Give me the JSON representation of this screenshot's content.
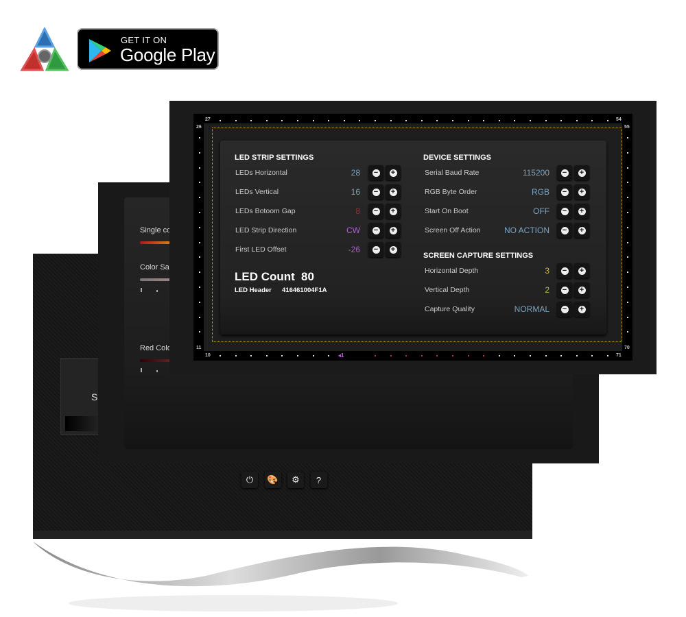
{
  "badge": {
    "line1": "GET IT ON",
    "line2": "Google Play"
  },
  "back_screen": {
    "card_label": "Sl"
  },
  "middle_screen": {
    "labels": [
      "Single co",
      "Color Sat",
      "Red Colo"
    ]
  },
  "led_frame": {
    "corner_labels": {
      "top_left_a": "27",
      "top_left_b": "26",
      "top_right_a": "54",
      "top_right_b": "55",
      "bottom_left_a": "11",
      "bottom_left_b": "10",
      "bottom_right_a": "70",
      "bottom_right_b": "71"
    },
    "start_marker": "◂1",
    "colors": {
      "start": "#c05de0",
      "active": "#c0392b",
      "idle": "#dddddd",
      "guide": "#b9a93a"
    }
  },
  "led_strip": {
    "title": "LED STRIP SETTINGS",
    "rows": [
      {
        "label": "LEDs Horizontal",
        "value": "28",
        "color": "#7aa3c4"
      },
      {
        "label": "LEDs Vertical",
        "value": "16",
        "color": "#7aa3c4"
      },
      {
        "label": "LEDs Botoom Gap",
        "value": "8",
        "color": "#c0201c"
      },
      {
        "label": "LED Strip Direction",
        "value": "CW",
        "color": "#b45fd0"
      },
      {
        "label": "First LED Offset",
        "value": "-26",
        "color": "#b45fd0"
      }
    ],
    "led_count_label": "LED Count",
    "led_count": "80",
    "led_header_label": "LED Header",
    "led_header": "416461004F1A"
  },
  "device": {
    "title": "DEVICE SETTINGS",
    "rows": [
      {
        "label": "Serial Baud Rate",
        "value": "115200",
        "color": "#7aa3c4"
      },
      {
        "label": "RGB Byte Order",
        "value": "RGB",
        "color": "#7aa3c4"
      },
      {
        "label": "Start On Boot",
        "value": "OFF",
        "color": "#7aa3c4"
      },
      {
        "label": "Screen Off Action",
        "value": "NO ACTION",
        "color": "#7aa3c4"
      }
    ]
  },
  "capture": {
    "title": "SCREEN CAPTURE SETTINGS",
    "rows": [
      {
        "label": "Horizontal Depth",
        "value": "3",
        "color": "#d8b534"
      },
      {
        "label": "Vertical Depth",
        "value": "2",
        "color": "#9fc43a"
      },
      {
        "label": "Capture Quality",
        "value": "NORMAL",
        "color": "#7aa3c4"
      }
    ]
  },
  "stepper": {
    "minus": "−",
    "plus": "+"
  },
  "bottom_buttons": [
    {
      "name": "power",
      "glyph": "⏻"
    },
    {
      "name": "palette",
      "glyph": "🎨"
    },
    {
      "name": "settings",
      "glyph": "⚙"
    },
    {
      "name": "help",
      "glyph": "?"
    }
  ]
}
